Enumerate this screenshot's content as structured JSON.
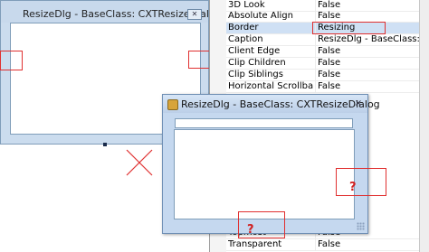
{
  "design_dialog": {
    "title": "ResizeDlg - BaseClass: CXTResizeDialog",
    "close_glyph": "✕"
  },
  "runtime_dialog": {
    "title": "ResizeDlg - BaseClass: CXTResizeDialog",
    "close_glyph": "×"
  },
  "annotations": {
    "question_mark": "?",
    "x_mark": "✕",
    "color": "#e03030"
  },
  "property_grid": {
    "rows": [
      {
        "name": "3D Look",
        "value": "False"
      },
      {
        "name": "Absolute Align",
        "value": "False"
      },
      {
        "name": "Border",
        "value": "Resizing"
      },
      {
        "name": "Caption",
        "value": "ResizeDlg - BaseClass: CXTResizeDialog"
      },
      {
        "name": "Client Edge",
        "value": "False"
      },
      {
        "name": "Clip Children",
        "value": "False"
      },
      {
        "name": "Clip Siblings",
        "value": "False"
      },
      {
        "name": "Horizontal Scrollbar",
        "value": "False"
      },
      {
        "name": "Topmost",
        "value": "False"
      },
      {
        "name": "Transparent",
        "value": "False"
      }
    ],
    "selected_index": 2
  }
}
